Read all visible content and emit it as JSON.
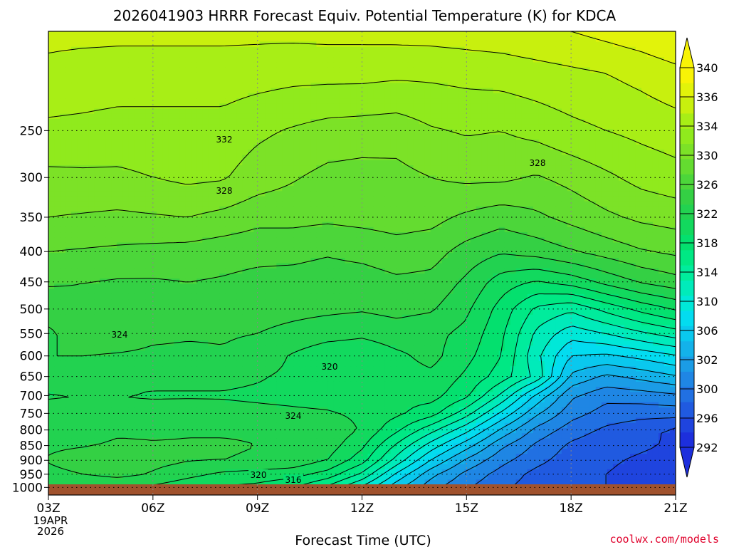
{
  "title": "2026041903 HRRR Forecast Equiv. Potential Temperature (K) for KDCA",
  "credit": "coolwx.com/models",
  "colors": {
    "ground": "#a0522d",
    "credit": "#e0002b",
    "contour": "#000000"
  },
  "chart_data": {
    "type": "heatmap",
    "title": "2026041903 HRRR Forecast Equiv. Potential Temperature (K) for KDCA",
    "xlabel": "Forecast Time (UTC)",
    "ylabel": "",
    "x_range_hours": [
      0,
      18
    ],
    "y_range_hpa": [
      170,
      1030
    ],
    "x_ticks": [
      {
        "hour": 0,
        "label": "03Z",
        "sub": [
          "19APR",
          "2026"
        ]
      },
      {
        "hour": 3,
        "label": "06Z"
      },
      {
        "hour": 6,
        "label": "09Z"
      },
      {
        "hour": 9,
        "label": "12Z"
      },
      {
        "hour": 12,
        "label": "15Z"
      },
      {
        "hour": 15,
        "label": "18Z"
      },
      {
        "hour": 18,
        "label": "21Z"
      }
    ],
    "y_ticks": [
      250,
      300,
      350,
      400,
      450,
      500,
      550,
      600,
      650,
      700,
      750,
      800,
      850,
      900,
      950,
      1000
    ],
    "colorbar": {
      "units": "K",
      "labels": [
        340,
        336,
        334,
        330,
        326,
        322,
        318,
        314,
        310,
        306,
        302,
        300,
        296,
        292
      ],
      "levels": [
        292,
        294,
        296,
        298,
        300,
        302,
        304,
        306,
        308,
        310,
        312,
        314,
        316,
        318,
        320,
        322,
        324,
        326,
        328,
        330,
        332,
        334,
        336,
        338,
        340,
        342
      ],
      "colors": [
        "#1d2fdc",
        "#1f44de",
        "#205ae0",
        "#2170e2",
        "#1f86e4",
        "#1b9ce6",
        "#13b2ea",
        "#0ac8ee",
        "#03dcf0",
        "#00e8d8",
        "#00ebba",
        "#00ec9c",
        "#00e884",
        "#04e06e",
        "#12d95e",
        "#22d250",
        "#34d044",
        "#4cd63a",
        "#64dc30",
        "#7ce227",
        "#90ea1d",
        "#a8ee16",
        "#c8f00e",
        "#e2f30a",
        "#f8f306"
      ]
    },
    "contour_labels": [
      "332",
      "328",
      "324",
      "320",
      "324",
      "320",
      "316",
      "328"
    ],
    "field": {
      "times_h": [
        0,
        1,
        2,
        3,
        4,
        5,
        6,
        7,
        8,
        9,
        10,
        11,
        12,
        13,
        14,
        15,
        16,
        17,
        18
      ],
      "pressure_hpa": [
        170,
        200,
        250,
        300,
        350,
        400,
        450,
        500,
        550,
        600,
        650,
        700,
        750,
        800,
        850,
        900,
        950,
        1000
      ],
      "theta_e_K": [
        [
          336.5,
          336.5,
          336.5,
          336.5,
          336.5,
          336.5,
          336.5,
          336.5,
          336.6,
          336.6,
          336.7,
          336.8,
          337,
          337.2,
          337.6,
          338,
          338.6,
          339.2,
          340
        ],
        [
          335.5,
          335.2,
          335,
          335,
          335,
          335,
          334.8,
          334.6,
          334.6,
          334.6,
          334.4,
          334.4,
          334.6,
          334.8,
          335.2,
          335.6,
          336,
          336.6,
          337.4
        ],
        [
          333.5,
          333.4,
          333.2,
          333.2,
          333.2,
          333.2,
          332.4,
          331.8,
          331.2,
          331,
          330.8,
          331.8,
          332.2,
          332,
          332.6,
          333.4,
          334,
          334.5,
          335
        ],
        [
          331.5,
          331.6,
          331.6,
          332,
          332.4,
          332.2,
          331,
          330.2,
          329.4,
          329.2,
          329.4,
          330,
          330.4,
          330.4,
          329.8,
          330.6,
          331.6,
          332.6,
          333.2
        ],
        [
          330,
          329.8,
          329.6,
          329.8,
          330,
          329.4,
          328.6,
          328.6,
          328.4,
          328.6,
          328.8,
          328.6,
          327.6,
          326.8,
          327.6,
          328.6,
          329.6,
          330.4,
          330.8
        ],
        [
          328,
          327.8,
          327.6,
          327.4,
          327.2,
          326.8,
          326.6,
          326.6,
          326.2,
          326.6,
          327.2,
          326.8,
          325.2,
          324.2,
          324.8,
          325.8,
          326.8,
          327.8,
          328.4
        ],
        [
          326.2,
          326,
          325.8,
          325.8,
          326,
          325.8,
          325.4,
          325.2,
          325,
          325,
          325.6,
          325.4,
          323.6,
          321,
          319.8,
          320.8,
          322.6,
          324.2,
          325.2
        ],
        [
          325,
          325.8,
          325.4,
          325.2,
          325.2,
          325,
          324.8,
          324.6,
          324.4,
          324.2,
          324.6,
          324.2,
          322.4,
          319.2,
          315.6,
          314.4,
          316.6,
          318.6,
          320.2
        ],
        [
          323.6,
          325.2,
          325.2,
          324.4,
          324.2,
          324.2,
          324,
          323.4,
          322.8,
          322.4,
          323,
          322.6,
          321.4,
          318.4,
          313.6,
          310.8,
          312,
          313.6,
          315
        ],
        [
          324,
          324,
          323.8,
          323.6,
          323.6,
          323.8,
          323.2,
          321.8,
          320.6,
          320.4,
          321.6,
          322.6,
          320.6,
          318,
          312.6,
          308,
          307.6,
          308.6,
          309.8
        ],
        [
          323.2,
          322.8,
          322.8,
          322.6,
          322.6,
          322.6,
          322.2,
          321.6,
          320.6,
          320.4,
          321.2,
          321.6,
          319.6,
          317,
          313.4,
          305.6,
          303.6,
          304.6,
          305.8
        ],
        [
          321.8,
          322,
          322,
          321.8,
          321.8,
          321.8,
          321.6,
          321.4,
          321.2,
          321,
          320.6,
          320.8,
          318.4,
          313.6,
          307.6,
          302.4,
          300.6,
          301,
          301.6
        ],
        [
          322.8,
          323,
          322.6,
          322.8,
          323,
          322.8,
          322.6,
          322.4,
          322.2,
          321.6,
          320.4,
          318.8,
          314.8,
          309.6,
          304.4,
          300.8,
          299.2,
          298.8,
          298.8
        ],
        [
          323.2,
          323,
          323.6,
          323.6,
          323.8,
          323.8,
          323.8,
          323.8,
          323.4,
          321.8,
          318.4,
          314.6,
          310.6,
          305.6,
          301.4,
          299,
          297.6,
          296.6,
          295.6
        ],
        [
          323.6,
          323.8,
          324.4,
          324.2,
          324.2,
          324.2,
          324,
          323.8,
          323,
          320.4,
          315.6,
          311,
          306.8,
          302.4,
          299.6,
          297.6,
          296.6,
          296.2,
          295.8
        ],
        [
          324.2,
          325.4,
          325.8,
          324.6,
          324.2,
          324,
          323.8,
          323.4,
          322,
          318.8,
          313.2,
          307.8,
          303.6,
          300.6,
          298.6,
          297,
          296.2,
          295.8,
          295.4
        ],
        [
          323.2,
          324,
          324.6,
          323.8,
          322.6,
          321.6,
          321.2,
          320.8,
          319.2,
          315.6,
          309.6,
          304.6,
          301.4,
          299.2,
          297.4,
          296.4,
          296,
          295.6,
          295.2
        ],
        [
          322.4,
          322,
          322.2,
          321.6,
          320.6,
          319.8,
          319.4,
          318.2,
          315.6,
          311.6,
          306.6,
          302.6,
          300.2,
          298.4,
          297,
          296.4,
          296,
          295.6,
          295.2
        ]
      ]
    }
  }
}
